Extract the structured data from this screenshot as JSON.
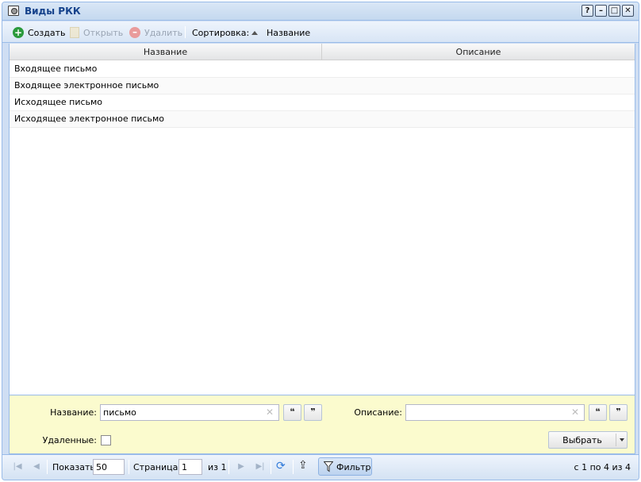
{
  "window": {
    "title": "Виды РКК",
    "controls": [
      "?",
      "–",
      "□",
      "✕"
    ]
  },
  "toolbar": {
    "create": "Создать",
    "open": "Открыть",
    "delete": "Удалить",
    "sort_label": "Сортировка:",
    "sort_field": "Название"
  },
  "grid": {
    "columns": [
      "Название",
      "Описание"
    ],
    "rows": [
      {
        "name": "Входящее письмо",
        "description": ""
      },
      {
        "name": "Входящее электронное письмо",
        "description": ""
      },
      {
        "name": "Исходящее письмо",
        "description": ""
      },
      {
        "name": "Исходящее электронное письмо",
        "description": ""
      }
    ]
  },
  "filter": {
    "name_label": "Название:",
    "name_value": "письмо",
    "description_label": "Описание:",
    "description_value": "",
    "quote_open": "❝",
    "quote_close": "❞",
    "deleted_label": "Удаленные:",
    "deleted_checked": false,
    "select_label": "Выбрать"
  },
  "pager": {
    "show_label": "Показать",
    "page_size": "50",
    "page_label": "Страница",
    "page_value": "1",
    "of_label": "из 1",
    "filter_label": "Фильтр",
    "summary": "с 1 по 4 из 4"
  }
}
